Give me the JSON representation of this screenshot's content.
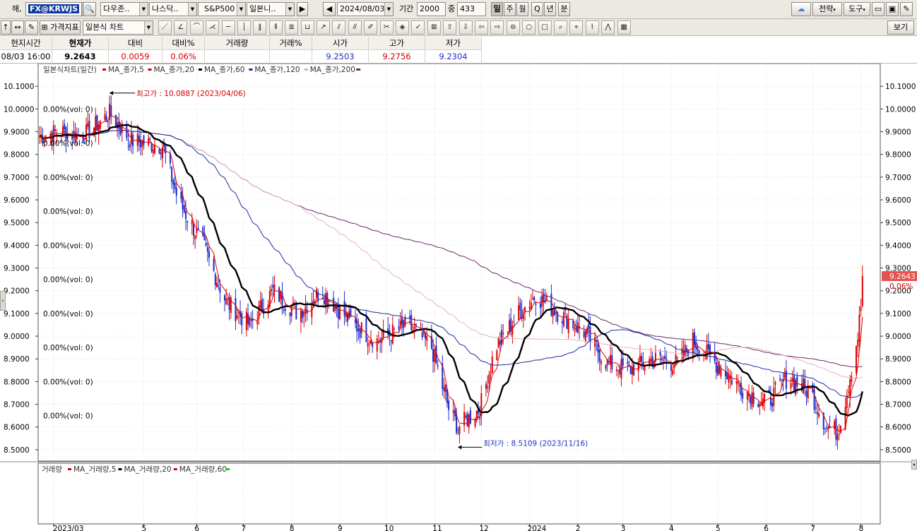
{
  "toolbar1": {
    "label_prefix": "해,",
    "symbol": "FX@KRWJS",
    "market1": "다우존..",
    "market2": "나스닥..",
    "market3": "S&P500",
    "market4": "일본니..",
    "date": "2024/08/03",
    "period_label": "기간",
    "period_value": "2000",
    "count_label": "중",
    "count_value": "433",
    "timeframes": [
      "일",
      "주",
      "월",
      "Q",
      "년",
      "분"
    ],
    "strategy_label": "전략",
    "tools_label": "도구"
  },
  "toolbar2": {
    "indicator_label": "가격지표",
    "chart_type": "일본식 차트",
    "view_label": "보기"
  },
  "info": {
    "headers": [
      "현지시간",
      "현재가",
      "대비",
      "대비%",
      "거래량",
      "거래%",
      "시가",
      "고가",
      "저가"
    ],
    "values": [
      "08/03   16:00",
      "9.2643",
      "0.0059",
      "0.06%",
      "",
      "",
      "9.2503",
      "9.2756",
      "9.2304"
    ]
  },
  "chart_data": {
    "type": "candlestick",
    "title": "일본식차트(일간)",
    "legend": [
      "MA_종가,5",
      "MA_종가,20",
      "MA_종가,60",
      "MA_종가,120",
      "MA_종가,200"
    ],
    "legend_colors": [
      "#d40000",
      "#d40000",
      "#000000",
      "#1d2c9c",
      "#e0a8b8"
    ],
    "volume_title": "거래량",
    "volume_legend": [
      "MA_거래량,5",
      "MA_거래량,20",
      "MA_거래량,60"
    ],
    "volume_legend_colors": [
      "#d40000",
      "#000000",
      "#d40000"
    ],
    "volume_end_colors": [
      "#d40000",
      "#000000",
      "#22cc22"
    ],
    "ylim": [
      8.45,
      10.2
    ],
    "y_ticks": [
      "10.1000",
      "10.0000",
      "9.9000",
      "9.8000",
      "9.7000",
      "9.6000",
      "9.5000",
      "9.4000",
      "9.3000",
      "9.2000",
      "9.1000",
      "9.0000",
      "8.9000",
      "8.8000",
      "8.7000",
      "8.6000",
      "8.5000"
    ],
    "x_labels": [
      "2023/03",
      "5",
      "6",
      "7",
      "8",
      "9",
      "10",
      "11",
      "12",
      "2024",
      "2",
      "3",
      "4",
      "5",
      "6",
      "7",
      "8"
    ],
    "x_label_dates": [
      "2023-03-01",
      "2023-04-28",
      "2023-06-01",
      "2023-07-01",
      "2023-08-01",
      "2023-09-01",
      "2023-10-01",
      "2023-11-01",
      "2023-12-01",
      "2024-01-01",
      "2024-02-01",
      "2024-03-01",
      "2024-04-01",
      "2024-05-01",
      "2024-06-01",
      "2024-07-01",
      "2024-08-01"
    ],
    "date_range": [
      "2023-02-20",
      "2024-08-03"
    ],
    "key_points": [
      {
        "date": "2023-02-20",
        "close": 9.88
      },
      {
        "date": "2023-03-05",
        "close": 9.9
      },
      {
        "date": "2023-03-20",
        "close": 9.88
      },
      {
        "date": "2023-04-06",
        "close": 9.98
      },
      {
        "date": "2023-04-20",
        "close": 9.86
      },
      {
        "date": "2023-05-10",
        "close": 9.84
      },
      {
        "date": "2023-05-20",
        "close": 9.6
      },
      {
        "date": "2023-06-05",
        "close": 9.4
      },
      {
        "date": "2023-06-20",
        "close": 9.15
      },
      {
        "date": "2023-07-05",
        "close": 9.05
      },
      {
        "date": "2023-07-20",
        "close": 9.2
      },
      {
        "date": "2023-08-05",
        "close": 9.1
      },
      {
        "date": "2023-08-20",
        "close": 9.2
      },
      {
        "date": "2023-09-10",
        "close": 9.05
      },
      {
        "date": "2023-09-25",
        "close": 8.98
      },
      {
        "date": "2023-10-15",
        "close": 9.05
      },
      {
        "date": "2023-10-30",
        "close": 8.95
      },
      {
        "date": "2023-11-10",
        "close": 8.68
      },
      {
        "date": "2023-11-16",
        "close": 8.6
      },
      {
        "date": "2023-11-30",
        "close": 8.68
      },
      {
        "date": "2023-12-10",
        "close": 8.95
      },
      {
        "date": "2023-12-25",
        "close": 9.1
      },
      {
        "date": "2024-01-05",
        "close": 9.18
      },
      {
        "date": "2024-01-20",
        "close": 9.1
      },
      {
        "date": "2024-02-05",
        "close": 9.02
      },
      {
        "date": "2024-02-20",
        "close": 8.88
      },
      {
        "date": "2024-03-05",
        "close": 8.85
      },
      {
        "date": "2024-03-20",
        "close": 8.9
      },
      {
        "date": "2024-04-05",
        "close": 8.88
      },
      {
        "date": "2024-04-15",
        "close": 8.98
      },
      {
        "date": "2024-04-30",
        "close": 8.88
      },
      {
        "date": "2024-05-15",
        "close": 8.78
      },
      {
        "date": "2024-06-01",
        "close": 8.7
      },
      {
        "date": "2024-06-15",
        "close": 8.82
      },
      {
        "date": "2024-06-30",
        "close": 8.75
      },
      {
        "date": "2024-07-10",
        "close": 8.6
      },
      {
        "date": "2024-07-17",
        "close": 8.58
      },
      {
        "date": "2024-07-22",
        "close": 8.72
      },
      {
        "date": "2024-07-30",
        "close": 9.0
      },
      {
        "date": "2024-08-03",
        "close": 9.2643
      }
    ],
    "annotations": {
      "high_text": "최고가 : 10.0887 (2023/04/06)",
      "high_value": 10.0887,
      "high_date": "2023-04-06",
      "low_text": "최저가 : 8.5109 (2023/11/16)",
      "low_value": 8.5109,
      "low_date": "2023-11-16",
      "current_value_label": "9.2643",
      "current_value": 9.2643,
      "current_change_label": "0.06%",
      "profile_labels": [
        "0.00%(vol: 0)",
        "0.00%(vol: 0)",
        "0.00%(vol: 0)",
        "0.00%(vol: 0)",
        "0.00%(vol: 0)",
        "0.00%(vol: 0)",
        "0.00%(vol: 0)",
        "0.00%(vol: 0)",
        "0.00%(vol: 0)",
        "0.00%(vol: 0)"
      ],
      "profile_values": [
        10.0,
        9.85,
        9.7,
        9.55,
        9.4,
        9.25,
        9.1,
        8.95,
        8.8,
        8.65
      ]
    },
    "colors": {
      "up": "#e00000",
      "down": "#1a2ccc",
      "ma5": "#e00000",
      "ma20": "#000000",
      "ma60": "#1d2c9c",
      "ma120": "#e8b0c0",
      "ma200": "#6a2a6a",
      "grid": "#d0d0d0"
    }
  }
}
